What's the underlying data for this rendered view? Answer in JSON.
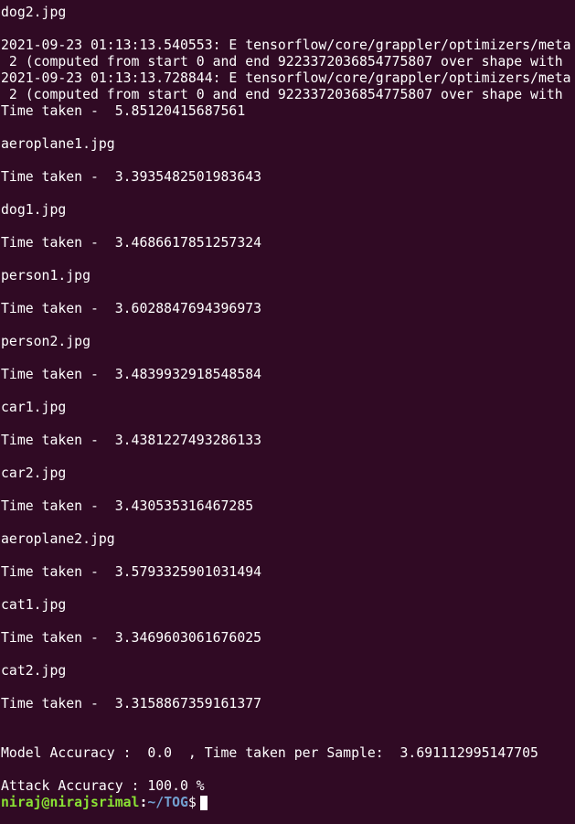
{
  "terminal": {
    "lines": [
      "dog2.jpg",
      "",
      "2021-09-23 01:13:13.540553: E tensorflow/core/grappler/optimizers/meta",
      " 2 (computed from start 0 and end 9223372036854775807 over shape with",
      "2021-09-23 01:13:13.728844: E tensorflow/core/grappler/optimizers/meta",
      " 2 (computed from start 0 and end 9223372036854775807 over shape with",
      "Time taken -  5.85120415687561",
      "",
      "aeroplane1.jpg",
      "",
      "Time taken -  3.3935482501983643",
      "",
      "dog1.jpg",
      "",
      "Time taken -  3.4686617851257324",
      "",
      "person1.jpg",
      "",
      "Time taken -  3.6028847694396973",
      "",
      "person2.jpg",
      "",
      "Time taken -  3.4839932918548584",
      "",
      "car1.jpg",
      "",
      "Time taken -  3.4381227493286133",
      "",
      "car2.jpg",
      "",
      "Time taken -  3.430535316467285",
      "",
      "aeroplane2.jpg",
      "",
      "Time taken -  3.5793325901031494",
      "",
      "cat1.jpg",
      "",
      "Time taken -  3.3469603061676025",
      "",
      "cat2.jpg",
      "",
      "Time taken -  3.3158867359161377",
      "",
      "",
      "Model Accuracy :  0.0  , Time taken per Sample:  3.691112995147705",
      "",
      "Attack Accuracy : 100.0 %"
    ],
    "prompt": {
      "user_host": "niraj@nirajsrimal",
      "colon": ":",
      "path": "~/TOG",
      "dollar": "$"
    },
    "colors": {
      "background": "#300a24",
      "text": "#ffffff",
      "user_host": "#8ae234",
      "path": "#729fcf"
    }
  }
}
